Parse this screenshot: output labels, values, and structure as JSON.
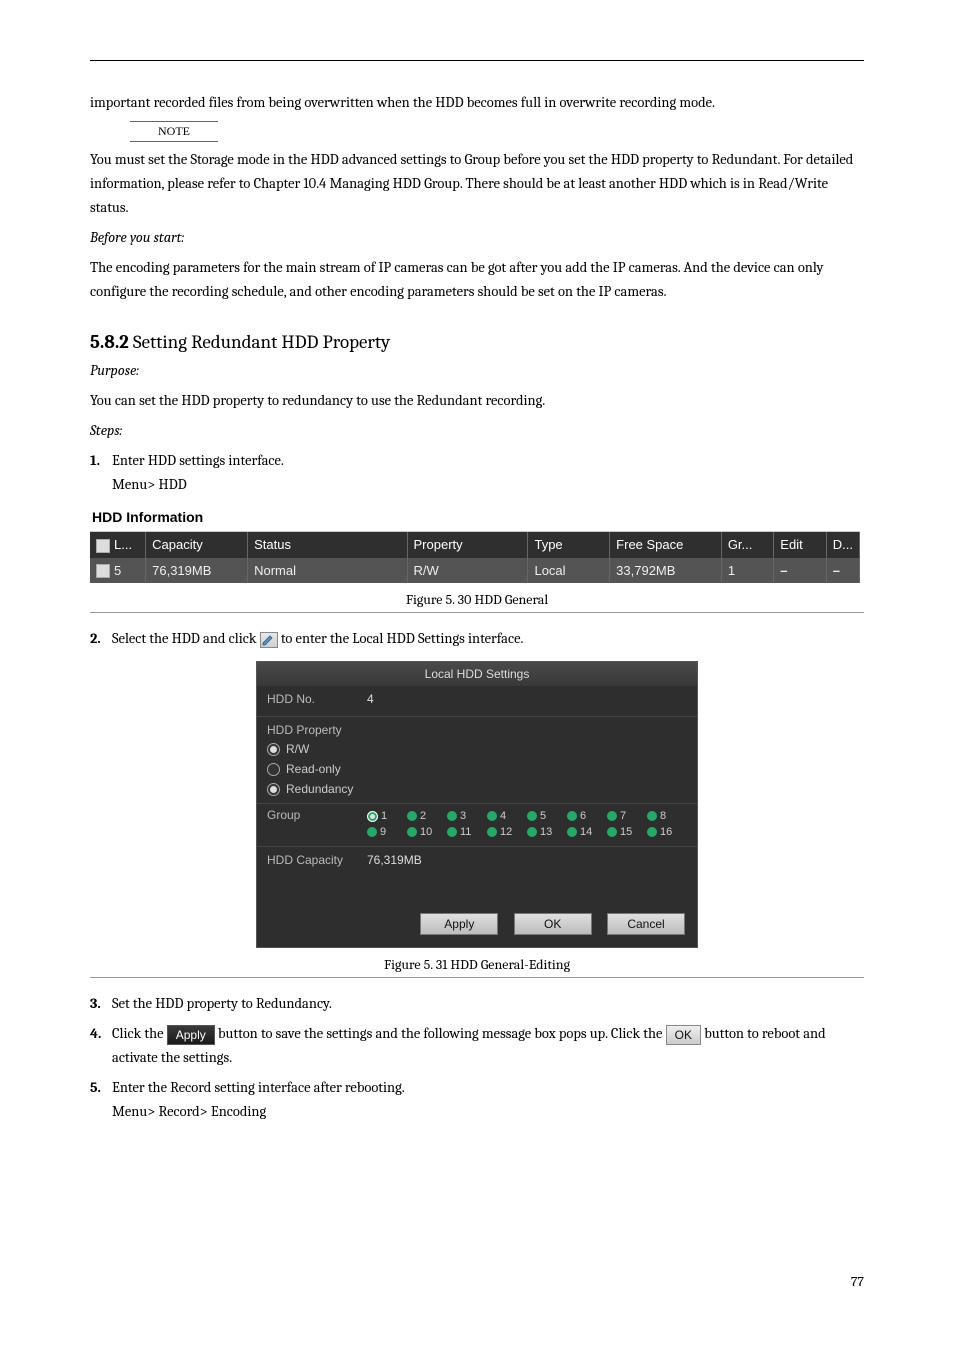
{
  "p1": "important recorded files from being overwritten when the HDD becomes full in overwrite recording mode.",
  "note_label": "NOTE",
  "note_text": "You must set the Storage mode in the HDD advanced settings to Group before you set the HDD property to Redundant. For detailed information, please refer to Chapter 10.4 Managing HDD Group. There should be at least another HDD which is in Read/Write status.",
  "before_label": "Before you start:",
  "before_text": "The encoding parameters for the main stream of IP cameras can be got after you add the IP cameras. And the device can only configure the recording schedule, and other encoding parameters should be set on the IP cameras.",
  "heading": {
    "num": "5.8.2",
    "title": "Setting Redundant HDD Property"
  },
  "purpose": {
    "label": "Purpose:",
    "text": "You can set the HDD property to redundancy to use the Redundant recording."
  },
  "steps_label": "Steps:",
  "steps": [
    {
      "n": "1.",
      "t": "Enter HDD settings interface.",
      "path": "Menu> HDD"
    },
    {
      "n": "2.",
      "t_a": "Select the HDD and click ",
      "t_b": " to enter the Local HDD Settings interface."
    },
    {
      "n": "3.",
      "t": "Set the HDD property to Redundancy."
    },
    {
      "n": "4.",
      "t_a": "Click the ",
      "btn1": "Apply",
      "t_b": " button to save the settings and the following message box pops up. Click the ",
      "btn2": "OK",
      "t_c": " button to reboot and activate the settings."
    },
    {
      "n": "5.",
      "t": "Enter the Record setting interface after rebooting.",
      "path": "Menu> Record> Encoding"
    }
  ],
  "hdd_info": {
    "title": "HDD Information",
    "headers": [
      "L...",
      "Capacity",
      "Status",
      "Property",
      "Type",
      "Free Space",
      "Gr...",
      "Edit",
      "D..."
    ],
    "rows": [
      {
        "l": "5",
        "capacity": "76,319MB",
        "status": "Normal",
        "property": "R/W",
        "type": "Local",
        "free": "33,792MB",
        "gr": "1",
        "edit": "–",
        "del": "–"
      }
    ]
  },
  "dlg": {
    "title": "Local HDD Settings",
    "hdd_no_label": "HDD No.",
    "hdd_no_value": "4",
    "property_label": "HDD Property",
    "props": [
      "R/W",
      "Read-only",
      "Redundancy"
    ],
    "group_label": "Group",
    "groups": [
      "1",
      "2",
      "3",
      "4",
      "5",
      "6",
      "7",
      "8",
      "9",
      "10",
      "11",
      "12",
      "13",
      "14",
      "15",
      "16"
    ],
    "group_selected": "1",
    "capacity_label": "HDD Capacity",
    "capacity_value": "76,319MB",
    "buttons": [
      "Apply",
      "OK",
      "Cancel"
    ]
  },
  "captions": {
    "fig30": "Figure 5. 30 HDD General",
    "fig31": "Figure 5. 31 HDD General-Editing"
  },
  "page_number": "77"
}
